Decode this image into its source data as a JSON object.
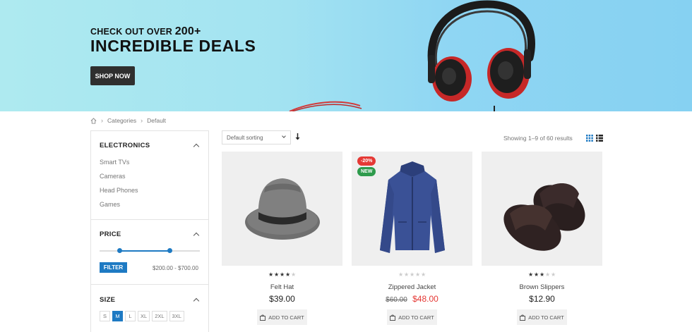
{
  "banner": {
    "subtitle_prefix": "CHECK OUT OVER",
    "subtitle_count": "200+",
    "title": "INCREDIBLE DEALS",
    "button_label": "SHOP NOW"
  },
  "breadcrumb": {
    "items": [
      "Categories",
      "Default"
    ]
  },
  "sidebar": {
    "electronics": {
      "heading": "ELECTRONICS",
      "items": [
        "Smart TVs",
        "Cameras",
        "Head Phones",
        "Games"
      ]
    },
    "price": {
      "heading": "PRICE",
      "filter_label": "FILTER",
      "range_text": "$200.00 - $700.00",
      "range_min_fraction": 0.2,
      "range_max_fraction": 0.7
    },
    "size": {
      "heading": "SIZE",
      "options": [
        "S",
        "M",
        "L",
        "XL",
        "2XL",
        "3XL"
      ],
      "selected": "M"
    }
  },
  "toolbar": {
    "sort_value": "Default sorting",
    "showing_text": "Showing 1–9 of 60 results"
  },
  "products": [
    {
      "name": "Felt Hat",
      "price": "$39.00",
      "old_price": "",
      "rating": 4,
      "add_to_cart": "ADD TO CART"
    },
    {
      "name": "Zippered Jacket",
      "price": "$48.00",
      "old_price": "$60.00",
      "rating": 0,
      "add_to_cart": "ADD TO CART",
      "badge_sale": "-20%",
      "badge_new": "NEW"
    },
    {
      "name": "Brown Slippers",
      "price": "$12.90",
      "old_price": "",
      "rating": 3,
      "add_to_cart": "ADD TO CART"
    }
  ],
  "colors": {
    "accent": "#1e7ac3",
    "sale": "#e53935",
    "new": "#2e9b4c",
    "banner_bg": "#a3e3f1"
  }
}
